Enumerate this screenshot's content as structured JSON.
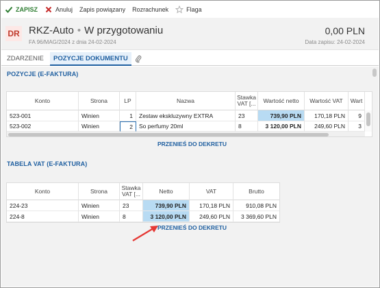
{
  "toolbar": {
    "save_label": "ZAPISZ",
    "cancel_label": "Anuluj",
    "linked_label": "Zapis powiązany",
    "settlement_label": "Rozrachunek",
    "flag_label": "Flaga"
  },
  "header": {
    "badge": "DR",
    "title": "RKZ-Auto",
    "status": "W przygotowaniu",
    "subtitle": "FA 96/MAG/2024 z dnia 24-02-2024",
    "amount": "0,00 PLN",
    "record_date": "Data zapisu: 24-02-2024"
  },
  "tabs": [
    {
      "label": "ZDARZENIE"
    },
    {
      "label": "POZYCJE DOKUMENTU"
    }
  ],
  "positions": {
    "title": "POZYCJE (E-FAKTURA)",
    "columns": [
      "Konto",
      "Strona",
      "LP",
      "Nazwa",
      "Stawka VAT [...",
      "Wartość netto",
      "Wartość VAT",
      "Wart"
    ],
    "rows": [
      {
        "konto": "523-001",
        "strona": "Winien",
        "lp": "1",
        "nazwa": "Zestaw ekskluzywny EXTRA",
        "stawka": "23",
        "netto": "739,90 PLN",
        "vat": "170,18 PLN",
        "wart": "9"
      },
      {
        "konto": "523-002",
        "strona": "Winien",
        "lp": "2",
        "nazwa": "So perfumy 20ml",
        "stawka": "8",
        "netto": "3 120,00 PLN",
        "vat": "249,60 PLN",
        "wart": "3"
      }
    ],
    "link": "PRZENIEŚ DO DEKRETU"
  },
  "vat_table": {
    "title": "TABELA VAT (E-FAKTURA)",
    "columns": [
      "Konto",
      "Strona",
      "Stawka VAT [...",
      "Netto",
      "VAT",
      "Brutto"
    ],
    "rows": [
      {
        "konto": "224-23",
        "strona": "Winien",
        "stawka": "23",
        "netto": "739,90 PLN",
        "vat": "170,18 PLN",
        "brutto": "910,08 PLN"
      },
      {
        "konto": "224-8",
        "strona": "Winien",
        "stawka": "8",
        "netto": "3 120,00 PLN",
        "vat": "249,60 PLN",
        "brutto": "3 369,60 PLN"
      }
    ],
    "link": "PRZENIEŚ DO DEKRETU"
  },
  "colors": {
    "accent": "#1f5fa0",
    "save_green": "#2e7d32",
    "cancel_red": "#c62828",
    "highlight": "#b8dbf3",
    "arrow_red": "#e53935"
  }
}
